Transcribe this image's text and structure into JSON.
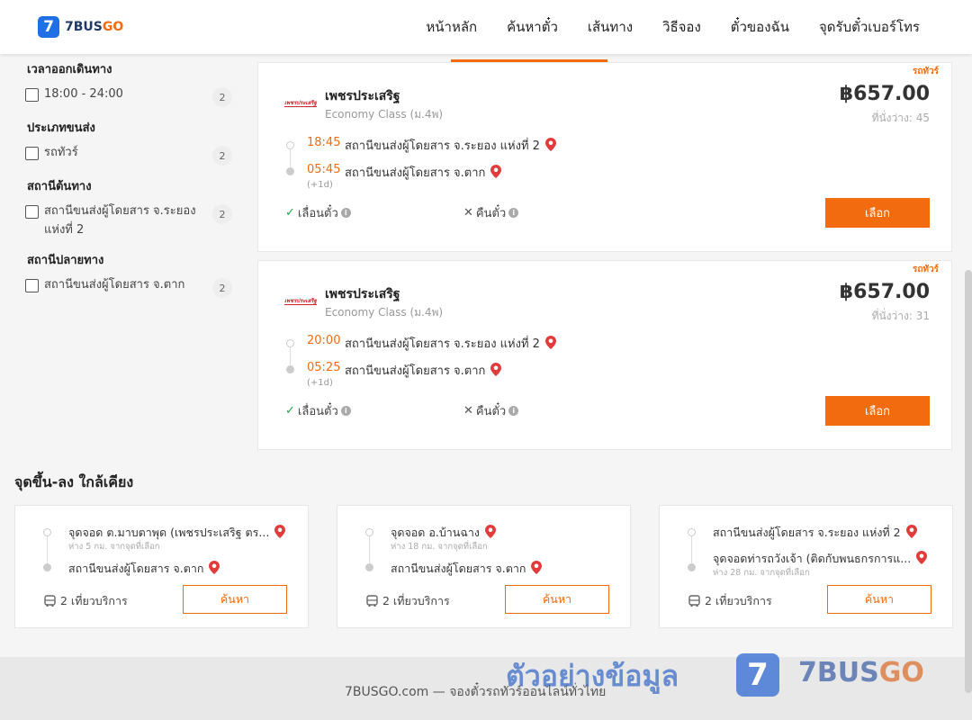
{
  "header": {
    "logo_mark": "7",
    "logo_text_a": "7BUS",
    "logo_text_b": "GO",
    "nav": [
      "หน้าหลัก",
      "ค้นหาตั๋ว",
      "เส้นทาง",
      "วิธีจอง",
      "ตั๋วของฉัน",
      "จุดรับตั๋วเบอร์โทร"
    ]
  },
  "filters": [
    {
      "title": "เวลาออกเดินทาง",
      "options": [
        {
          "label": "18:00 - 24:00",
          "count": "2"
        }
      ]
    },
    {
      "title": "ประเภทขนส่ง",
      "options": [
        {
          "label": "รถทัวร์",
          "count": "2"
        }
      ]
    },
    {
      "title": "สถานีต้นทาง",
      "options": [
        {
          "label": "สถานีขนส่งผู้โดยสาร จ.ระยอง แห่งที่ 2",
          "count": "2"
        }
      ]
    },
    {
      "title": "สถานีปลายทาง",
      "options": [
        {
          "label": "สถานีขนส่งผู้โดยสาร จ.ตาก",
          "count": "2"
        }
      ]
    }
  ],
  "trips": [
    {
      "badge": "รถทัวร์",
      "operator": "เพชรประเสริฐ",
      "bus_class": "Economy Class (ม.4พ)",
      "price": "฿657.00",
      "seats": "ที่นั่งว่าง: 45",
      "depart_time": "18:45",
      "depart_station": "สถานีขนส่งผู้โดยสาร จ.ระยอง แห่งที่ 2",
      "arrive_time": "05:45",
      "arrive_station": "สถานีขนส่งผู้โดยสาร จ.ตาก",
      "next_day": "(+1d)",
      "policy_change": "เลื่อนตั๋ว",
      "policy_refund": "คืนตั๋ว",
      "select_label": "เลือก"
    },
    {
      "badge": "รถทัวร์",
      "operator": "เพชรประเสริฐ",
      "bus_class": "Economy Class (ม.4พ)",
      "price": "฿657.00",
      "seats": "ที่นั่งว่าง: 31",
      "depart_time": "20:00",
      "depart_station": "สถานีขนส่งผู้โดยสาร จ.ระยอง แห่งที่ 2",
      "arrive_time": "05:25",
      "arrive_station": "สถานีขนส่งผู้โดยสาร จ.ตาก",
      "next_day": "(+1d)",
      "policy_change": "เลื่อนตั๋ว",
      "policy_refund": "คืนตั๋ว",
      "select_label": "เลือก"
    }
  ],
  "nearby": {
    "title": "จุดขึ้น-ลง ใกล้เคียง",
    "cards": [
      {
        "from": "จุดจอด ต.มาบตาพุด (เพชรประเสริฐ ตร...",
        "from_sub": "ห่าง 5 กม. จากจุดที่เลือก",
        "to": "สถานีขนส่งผู้โดยสาร จ.ตาก",
        "to_sub": "",
        "trips": "2 เที่ยวบริการ",
        "button": "ค้นหา"
      },
      {
        "from": "จุดจอด อ.บ้านฉาง",
        "from_sub": "ห่าง 18 กม. จากจุดที่เลือก",
        "to": "สถานีขนส่งผู้โดยสาร จ.ตาก",
        "to_sub": "",
        "trips": "2 เที่ยวบริการ",
        "button": "ค้นหา"
      },
      {
        "from": "สถานีขนส่งผู้โดยสาร จ.ระยอง แห่งที่ 2",
        "from_sub": "",
        "to": "จุดจอดท่ารถวังเจ้า (ติดกับพนธกรการแ...",
        "to_sub": "ห่าง 28 กม. จากจุดที่เลือก",
        "trips": "2 เที่ยวบริการ",
        "button": "ค้นหา"
      }
    ]
  },
  "footer": {
    "text": "7BUSGO.com — จองตั๋วรถทัวร์ออนไลน์ทั่วไทย"
  },
  "watermark": {
    "text": "ตัวอย่างข้อมูล",
    "logo_mark": "7",
    "brand_a": "7BUS",
    "brand_b": "GO"
  },
  "colors": {
    "accent": "#f26b0e",
    "brand_blue": "#1f6fe5",
    "check_green": "#22a04b"
  }
}
